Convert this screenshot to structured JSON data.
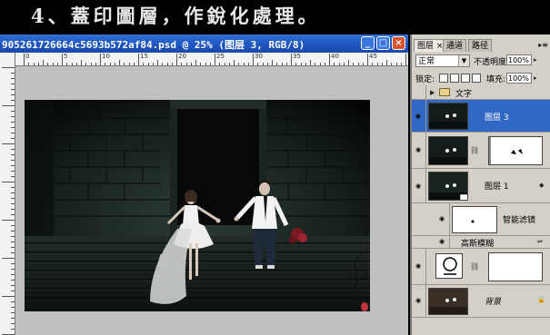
{
  "caption": "4、蓋印圖層，作銳化處理。",
  "document": {
    "title": "905261726664c5693b572af84.psd @ 25% (图层 3, RGB/8)",
    "ruler_labels": [
      "0",
      "5",
      "10",
      "15",
      "20",
      "25",
      "30",
      "35",
      "40",
      "45",
      "50"
    ],
    "min_label": "_",
    "max_label": "□",
    "close_label": "×"
  },
  "panel": {
    "tabs": [
      {
        "label": "图层 ×"
      },
      {
        "label": "通道"
      },
      {
        "label": "路径"
      }
    ],
    "blend_mode": "正常",
    "opacity_label": "不透明度:",
    "opacity_value": "100%",
    "lock_label": "锁定:",
    "fill_label": "填充:",
    "fill_value": "100%",
    "layers": [
      {
        "name": "文字",
        "kind": "group"
      },
      {
        "name": "图层 3",
        "kind": "layer",
        "selected": true
      },
      {
        "name": "",
        "kind": "masked"
      },
      {
        "name": "图层 1",
        "kind": "smart"
      },
      {
        "name": "智能滤镜",
        "kind": "filtermask"
      },
      {
        "name": "高斯模糊",
        "kind": "filter"
      },
      {
        "name": "",
        "kind": "adjust"
      },
      {
        "name": "背景",
        "kind": "background"
      }
    ]
  },
  "colors": {
    "titlebar": "#1f55c0",
    "selected_layer": "#3168c5",
    "panel_bg": "#d4d0c8"
  }
}
